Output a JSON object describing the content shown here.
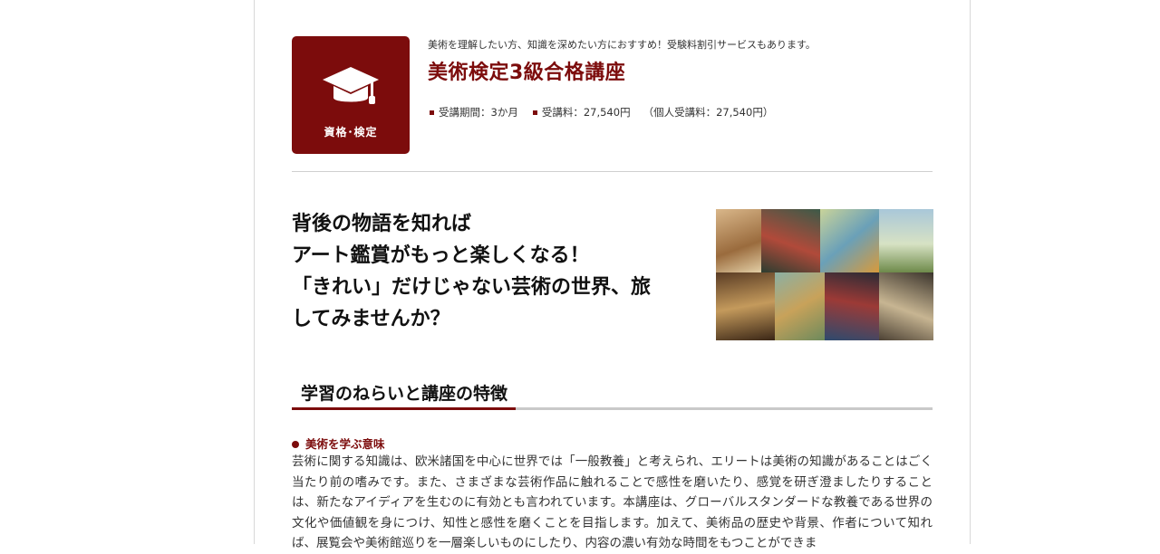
{
  "badge": {
    "label": "資格･検定",
    "icon": "graduation-cap-icon"
  },
  "header": {
    "lead": "美術を理解したい方、知識を深めたい方におすすめ！受験料割引サービスもあります。",
    "title": "美術検定3級合格講座",
    "meta": {
      "period": "受講期間：3か月",
      "fee": "受講料：27,540円",
      "individual_fee": "（個人受講料：27,540円）"
    }
  },
  "catch_lines": [
    "背後の物語を知れば",
    "アート鑑賞がもっと楽しくなる！",
    "「きれい」だけじゃない芸術の世界、旅",
    "してみませんか？"
  ],
  "section": {
    "title": "学習のねらいと講座の特徴",
    "subheading": "美術を学ぶ意味",
    "body": "芸術に関する知識は、欧米諸国を中心に世界では「一般教養」と考えられ、エリートは美術の知識があることはごく当たり前の嗜みです。また、さまざまな芸術作品に触れることで感性を磨いたり、感覚を研ぎ澄ましたりすることは、新たなアイディアを生むのに有効とも言われています。本講座は、グローバルスタンダードな教養である世界の文化や価値観を身につけ、知性と感性を磨くことを目指します。加えて、美術品の歴史や背景、作者について知れば、展覧会や美術館巡りを一層楽しいものにしたり、内容の濃い有効な時間をもつことができま"
  },
  "colors": {
    "accent": "#7c0c0c",
    "rule": "#d0d0d0"
  }
}
